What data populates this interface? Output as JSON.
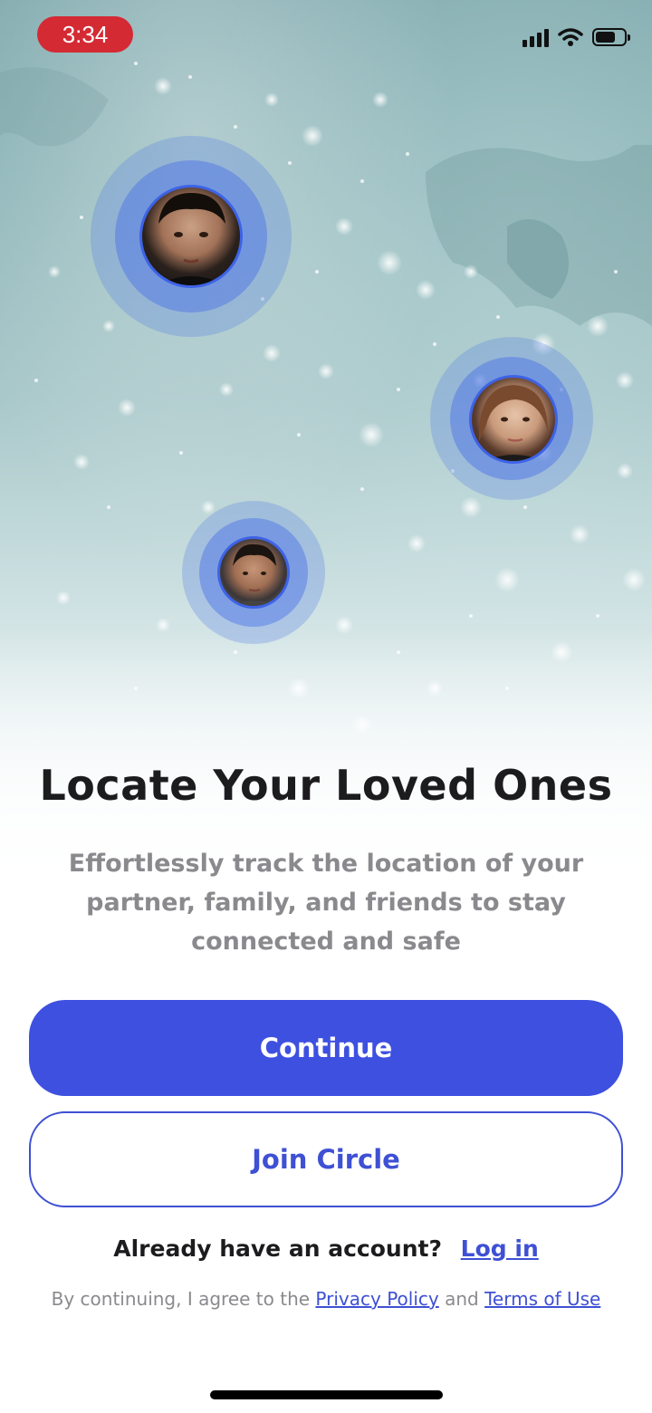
{
  "status_bar": {
    "time": "3:34",
    "battery_level": 0.7,
    "icons": [
      "signal-icon",
      "wifi-icon",
      "battery-icon"
    ]
  },
  "map": {
    "avatars": [
      "avatar-young-man",
      "avatar-young-woman",
      "avatar-teen-boy"
    ]
  },
  "onboarding": {
    "title": "Locate Your Loved Ones",
    "subtitle": "Effortlessly track the location of your partner, family, and friends to stay connected and safe"
  },
  "actions": {
    "continue_label": "Continue",
    "join_label": "Join Circle"
  },
  "account": {
    "prompt": "Already have an account?",
    "login_label": "Log in"
  },
  "legal": {
    "prefix": "By continuing, I agree to the",
    "privacy_label": "Privacy Policy",
    "and": "and",
    "terms_label": "Terms of Use"
  },
  "colors": {
    "accent": "#3e50e0",
    "time_pill": "#d42a34",
    "title": "#1c1c1e",
    "subtitle": "#8a8a8e"
  }
}
